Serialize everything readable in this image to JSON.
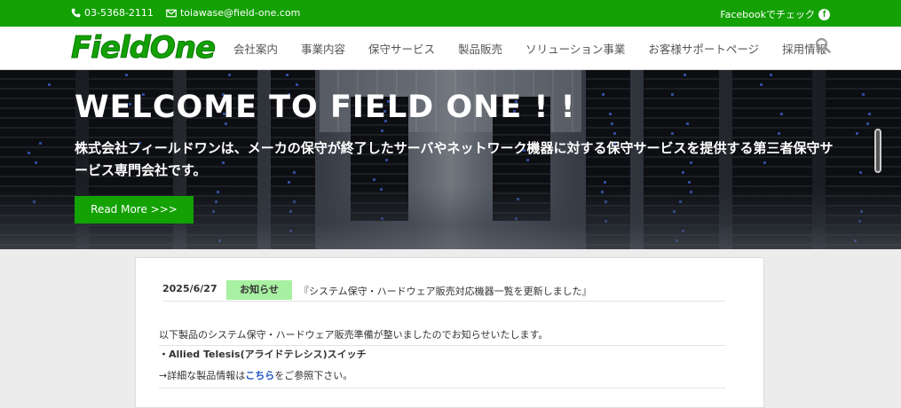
{
  "topbar": {
    "phone": "03-5368-2111",
    "email": "toiawase@field-one.com",
    "facebook_label": "Facebookでチェック"
  },
  "header": {
    "logo_text": "FieldOne",
    "menu": [
      "会社案内",
      "事業内容",
      "保守サービス",
      "製品販売",
      "ソリューション事業",
      "お客様サポートページ",
      "採用情報"
    ]
  },
  "hero": {
    "title": "WELCOME TO FIELD ONE ! !",
    "description": "株式会社フィールドワンは、メーカの保守が終了したサーバやネットワーク機器に対する保守サービスを提供する第三者保守サービス専門会社です。",
    "button_label": "Read More >>>"
  },
  "news": {
    "date": "2025/6/27",
    "badge": "お知らせ",
    "title": "『システム保守・ハードウェア販売対応機器一覧を更新しました』",
    "body_line1": "以下製品のシステム保守・ハードウェア販売準備が整いましたのでお知らせいたします。",
    "body_line2": "・Allied Telesis(アライドテレシス)スイッチ",
    "body_line3_prefix": "→詳細な製品情報は",
    "body_line3_link": "こちら",
    "body_line3_suffix": "をご参照下さい。"
  },
  "colors": {
    "brand_green": "#13a104",
    "badge_green": "#a8f0a2",
    "link_blue": "#1a53c4"
  }
}
